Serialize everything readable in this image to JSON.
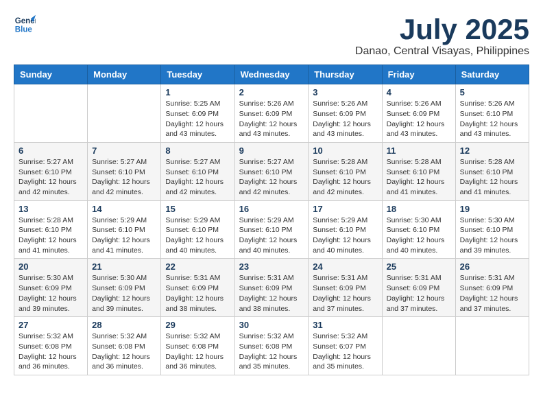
{
  "logo": {
    "line1": "General",
    "line2": "Blue"
  },
  "title": "July 2025",
  "subtitle": "Danao, Central Visayas, Philippines",
  "days_of_week": [
    "Sunday",
    "Monday",
    "Tuesday",
    "Wednesday",
    "Thursday",
    "Friday",
    "Saturday"
  ],
  "weeks": [
    [
      {
        "day": "",
        "sunrise": "",
        "sunset": "",
        "daylight": ""
      },
      {
        "day": "",
        "sunrise": "",
        "sunset": "",
        "daylight": ""
      },
      {
        "day": "1",
        "sunrise": "Sunrise: 5:25 AM",
        "sunset": "Sunset: 6:09 PM",
        "daylight": "Daylight: 12 hours and 43 minutes."
      },
      {
        "day": "2",
        "sunrise": "Sunrise: 5:26 AM",
        "sunset": "Sunset: 6:09 PM",
        "daylight": "Daylight: 12 hours and 43 minutes."
      },
      {
        "day": "3",
        "sunrise": "Sunrise: 5:26 AM",
        "sunset": "Sunset: 6:09 PM",
        "daylight": "Daylight: 12 hours and 43 minutes."
      },
      {
        "day": "4",
        "sunrise": "Sunrise: 5:26 AM",
        "sunset": "Sunset: 6:09 PM",
        "daylight": "Daylight: 12 hours and 43 minutes."
      },
      {
        "day": "5",
        "sunrise": "Sunrise: 5:26 AM",
        "sunset": "Sunset: 6:10 PM",
        "daylight": "Daylight: 12 hours and 43 minutes."
      }
    ],
    [
      {
        "day": "6",
        "sunrise": "Sunrise: 5:27 AM",
        "sunset": "Sunset: 6:10 PM",
        "daylight": "Daylight: 12 hours and 42 minutes."
      },
      {
        "day": "7",
        "sunrise": "Sunrise: 5:27 AM",
        "sunset": "Sunset: 6:10 PM",
        "daylight": "Daylight: 12 hours and 42 minutes."
      },
      {
        "day": "8",
        "sunrise": "Sunrise: 5:27 AM",
        "sunset": "Sunset: 6:10 PM",
        "daylight": "Daylight: 12 hours and 42 minutes."
      },
      {
        "day": "9",
        "sunrise": "Sunrise: 5:27 AM",
        "sunset": "Sunset: 6:10 PM",
        "daylight": "Daylight: 12 hours and 42 minutes."
      },
      {
        "day": "10",
        "sunrise": "Sunrise: 5:28 AM",
        "sunset": "Sunset: 6:10 PM",
        "daylight": "Daylight: 12 hours and 42 minutes."
      },
      {
        "day": "11",
        "sunrise": "Sunrise: 5:28 AM",
        "sunset": "Sunset: 6:10 PM",
        "daylight": "Daylight: 12 hours and 41 minutes."
      },
      {
        "day": "12",
        "sunrise": "Sunrise: 5:28 AM",
        "sunset": "Sunset: 6:10 PM",
        "daylight": "Daylight: 12 hours and 41 minutes."
      }
    ],
    [
      {
        "day": "13",
        "sunrise": "Sunrise: 5:28 AM",
        "sunset": "Sunset: 6:10 PM",
        "daylight": "Daylight: 12 hours and 41 minutes."
      },
      {
        "day": "14",
        "sunrise": "Sunrise: 5:29 AM",
        "sunset": "Sunset: 6:10 PM",
        "daylight": "Daylight: 12 hours and 41 minutes."
      },
      {
        "day": "15",
        "sunrise": "Sunrise: 5:29 AM",
        "sunset": "Sunset: 6:10 PM",
        "daylight": "Daylight: 12 hours and 40 minutes."
      },
      {
        "day": "16",
        "sunrise": "Sunrise: 5:29 AM",
        "sunset": "Sunset: 6:10 PM",
        "daylight": "Daylight: 12 hours and 40 minutes."
      },
      {
        "day": "17",
        "sunrise": "Sunrise: 5:29 AM",
        "sunset": "Sunset: 6:10 PM",
        "daylight": "Daylight: 12 hours and 40 minutes."
      },
      {
        "day": "18",
        "sunrise": "Sunrise: 5:30 AM",
        "sunset": "Sunset: 6:10 PM",
        "daylight": "Daylight: 12 hours and 40 minutes."
      },
      {
        "day": "19",
        "sunrise": "Sunrise: 5:30 AM",
        "sunset": "Sunset: 6:10 PM",
        "daylight": "Daylight: 12 hours and 39 minutes."
      }
    ],
    [
      {
        "day": "20",
        "sunrise": "Sunrise: 5:30 AM",
        "sunset": "Sunset: 6:09 PM",
        "daylight": "Daylight: 12 hours and 39 minutes."
      },
      {
        "day": "21",
        "sunrise": "Sunrise: 5:30 AM",
        "sunset": "Sunset: 6:09 PM",
        "daylight": "Daylight: 12 hours and 39 minutes."
      },
      {
        "day": "22",
        "sunrise": "Sunrise: 5:31 AM",
        "sunset": "Sunset: 6:09 PM",
        "daylight": "Daylight: 12 hours and 38 minutes."
      },
      {
        "day": "23",
        "sunrise": "Sunrise: 5:31 AM",
        "sunset": "Sunset: 6:09 PM",
        "daylight": "Daylight: 12 hours and 38 minutes."
      },
      {
        "day": "24",
        "sunrise": "Sunrise: 5:31 AM",
        "sunset": "Sunset: 6:09 PM",
        "daylight": "Daylight: 12 hours and 37 minutes."
      },
      {
        "day": "25",
        "sunrise": "Sunrise: 5:31 AM",
        "sunset": "Sunset: 6:09 PM",
        "daylight": "Daylight: 12 hours and 37 minutes."
      },
      {
        "day": "26",
        "sunrise": "Sunrise: 5:31 AM",
        "sunset": "Sunset: 6:09 PM",
        "daylight": "Daylight: 12 hours and 37 minutes."
      }
    ],
    [
      {
        "day": "27",
        "sunrise": "Sunrise: 5:32 AM",
        "sunset": "Sunset: 6:08 PM",
        "daylight": "Daylight: 12 hours and 36 minutes."
      },
      {
        "day": "28",
        "sunrise": "Sunrise: 5:32 AM",
        "sunset": "Sunset: 6:08 PM",
        "daylight": "Daylight: 12 hours and 36 minutes."
      },
      {
        "day": "29",
        "sunrise": "Sunrise: 5:32 AM",
        "sunset": "Sunset: 6:08 PM",
        "daylight": "Daylight: 12 hours and 36 minutes."
      },
      {
        "day": "30",
        "sunrise": "Sunrise: 5:32 AM",
        "sunset": "Sunset: 6:08 PM",
        "daylight": "Daylight: 12 hours and 35 minutes."
      },
      {
        "day": "31",
        "sunrise": "Sunrise: 5:32 AM",
        "sunset": "Sunset: 6:07 PM",
        "daylight": "Daylight: 12 hours and 35 minutes."
      },
      {
        "day": "",
        "sunrise": "",
        "sunset": "",
        "daylight": ""
      },
      {
        "day": "",
        "sunrise": "",
        "sunset": "",
        "daylight": ""
      }
    ]
  ]
}
